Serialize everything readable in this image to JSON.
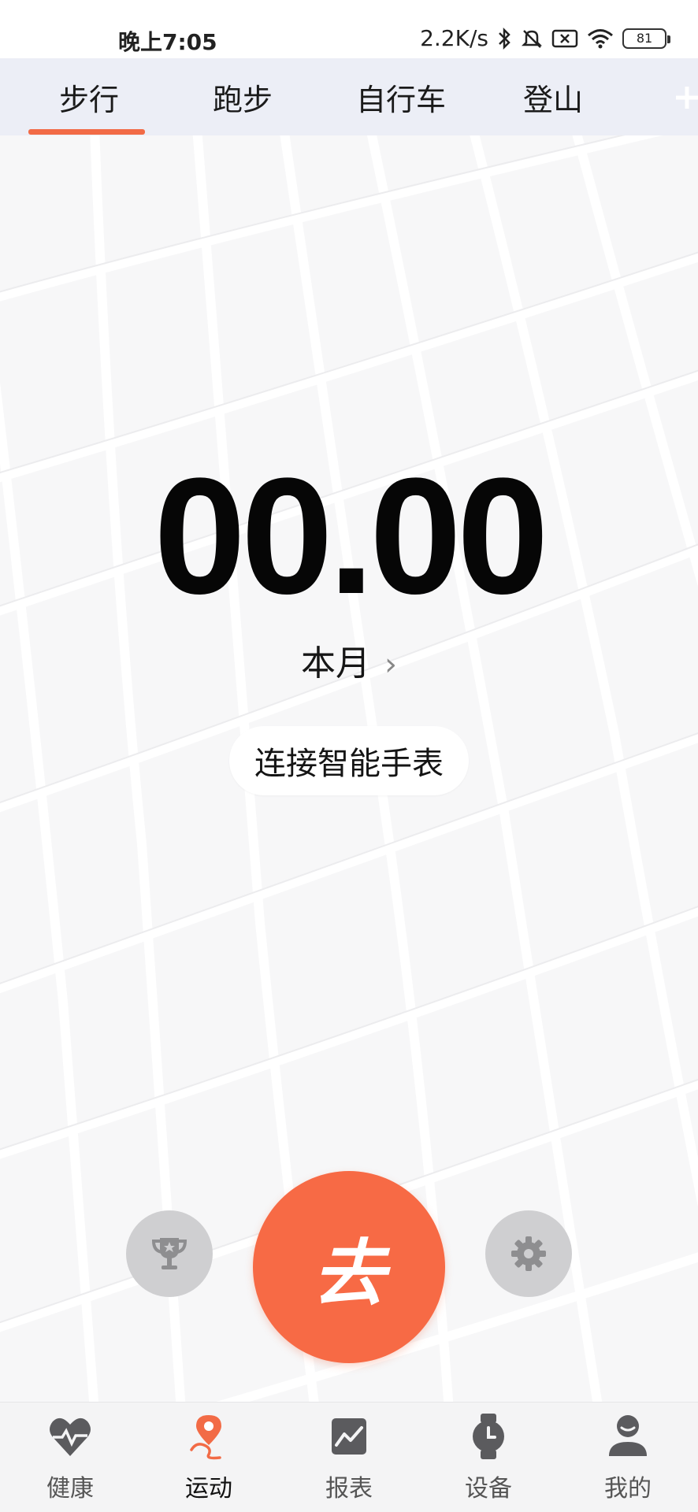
{
  "status_bar": {
    "time": "晚上7:05",
    "network_speed": "2.2K/s",
    "battery": "81",
    "icons": [
      "bluetooth-icon",
      "mute-icon",
      "sim-off-icon",
      "wifi-icon",
      "battery-icon"
    ]
  },
  "tabs": [
    {
      "label": "步行",
      "active": true
    },
    {
      "label": "跑步",
      "active": false
    },
    {
      "label": "自行车",
      "active": false
    },
    {
      "label": "登山",
      "active": false
    }
  ],
  "main": {
    "distance": "00.00",
    "period_label": "本月",
    "period_chevron": "›",
    "connect_label": "连接智能手表",
    "go_label": "去"
  },
  "bottom_nav": [
    {
      "label": "健康",
      "icon": "heart-pulse-icon",
      "active": false
    },
    {
      "label": "运动",
      "icon": "location-pin-icon",
      "active": true
    },
    {
      "label": "报表",
      "icon": "chart-icon",
      "active": false
    },
    {
      "label": "设备",
      "icon": "watch-icon",
      "active": false
    },
    {
      "label": "我的",
      "icon": "person-icon",
      "active": false
    }
  ],
  "colors": {
    "accent": "#f76a45",
    "tab_bg": "#eceef6",
    "map_bg": "#f7f7f8",
    "round_btn": "#cfcfd1"
  }
}
